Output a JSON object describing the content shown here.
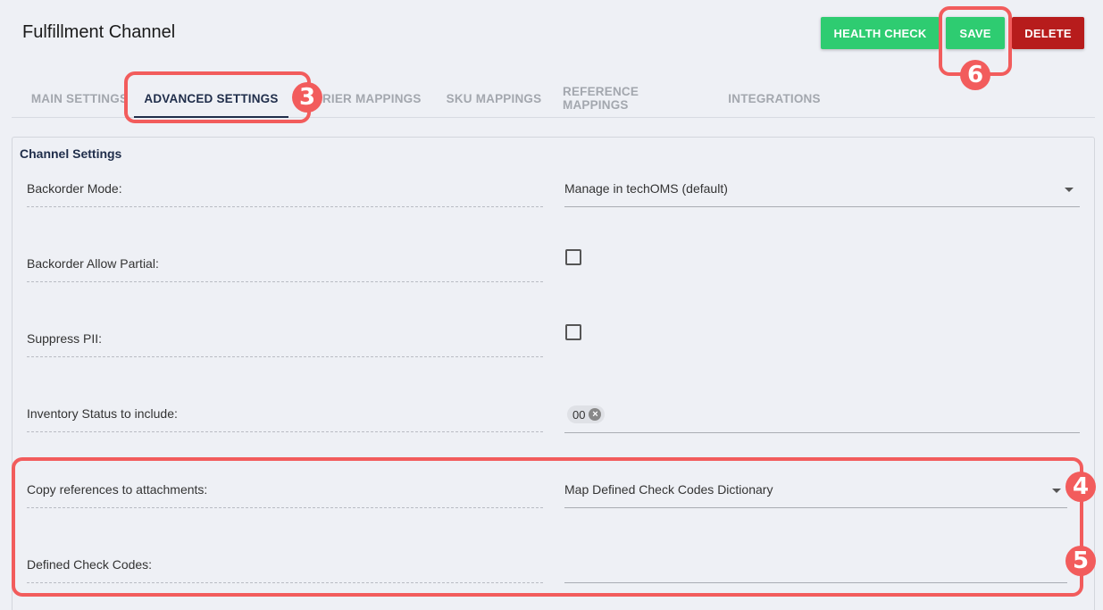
{
  "header": {
    "title": "Fulfillment Channel",
    "buttons": {
      "health_check": "HEALTH CHECK",
      "save": "SAVE",
      "delete": "DELETE"
    }
  },
  "tabs": [
    {
      "label": "MAIN SETTINGS",
      "active": false
    },
    {
      "label": "ADVANCED SETTINGS",
      "active": true
    },
    {
      "label": "CARRIER MAPPINGS",
      "visible_text": "RRIER MAPPINGS",
      "active": false
    },
    {
      "label": "SKU MAPPINGS",
      "active": false
    },
    {
      "label": "REFERENCE MAPPINGS",
      "active": false
    },
    {
      "label": "INTEGRATIONS",
      "active": false
    }
  ],
  "channel_settings": {
    "title": "Channel Settings",
    "rows": [
      {
        "label": "Backorder Mode:",
        "type": "select",
        "value": "Manage in techOMS (default)"
      },
      {
        "label": "Backorder Allow Partial:",
        "type": "checkbox",
        "checked": false
      },
      {
        "label": "Suppress PII:",
        "type": "checkbox",
        "checked": false
      },
      {
        "label": "Inventory Status to include:",
        "type": "chips",
        "chips": [
          "00"
        ]
      },
      {
        "label": "Copy references to attachments:",
        "type": "select",
        "value": "Map Defined Check Codes Dictionary"
      },
      {
        "label": "Defined Check Codes:",
        "type": "text",
        "value": ""
      }
    ]
  },
  "annotations": {
    "badge_3": "3",
    "badge_4": "4",
    "badge_5": "5",
    "badge_6": "6",
    "highlight_color": "#f25c5c"
  },
  "colors": {
    "primary_green": "#2ecc71",
    "danger_red": "#b71c1c",
    "navy": "#1f2d4a"
  }
}
